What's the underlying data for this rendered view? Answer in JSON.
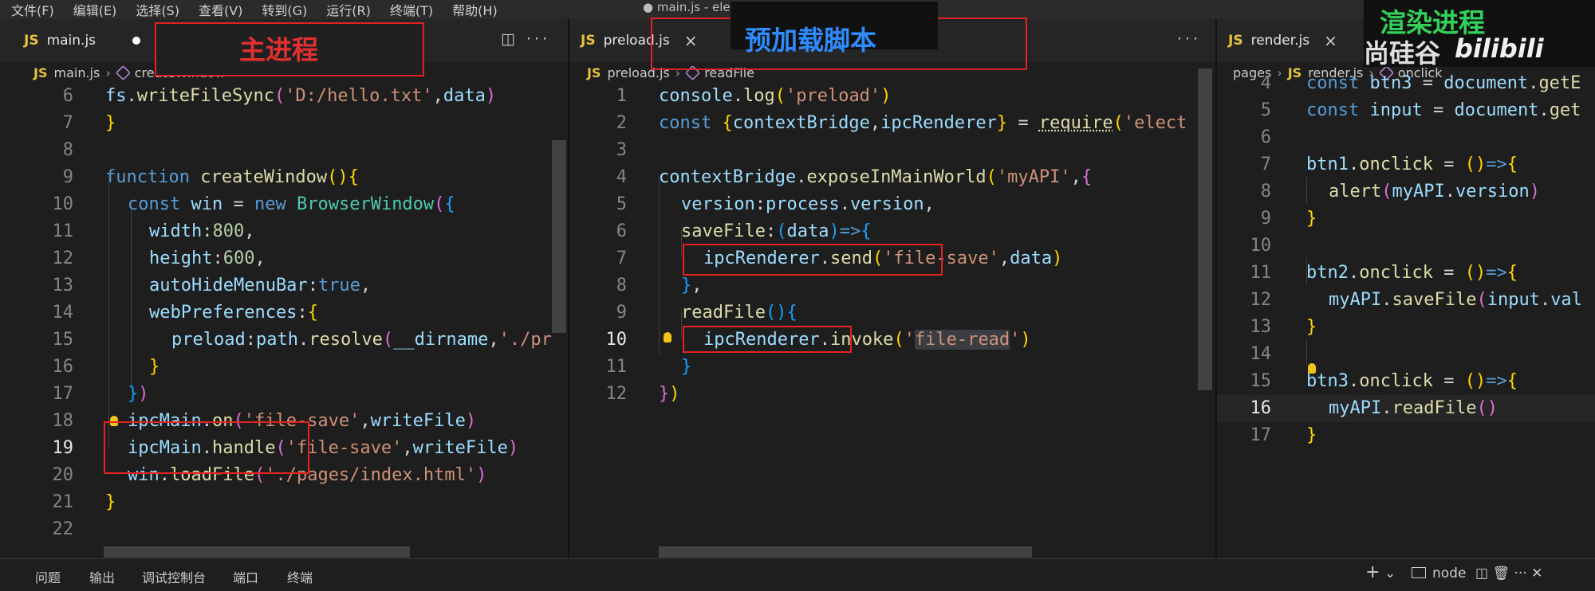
{
  "menubar": {
    "items": [
      "文件(F)",
      "编辑(E)",
      "选择(S)",
      "查看(V)",
      "转到(G)",
      "运行(R)",
      "终端(T)",
      "帮助(H)"
    ],
    "window_title": "● main.js - ele"
  },
  "overlays": {
    "main_process": "主进程",
    "preload_script": "预加载脚本",
    "render_process": "渲染进程",
    "watermark": "尚硅谷",
    "bilibili": "bilibili"
  },
  "colors": {
    "accent_red": "#e32222",
    "label_red": "#e23030",
    "label_blue": "#2f8cff",
    "label_green": "#33d15a"
  },
  "pane1": {
    "tab": {
      "prefix": "JS",
      "name": "main.js",
      "modified": true
    },
    "tools": "◫ ···",
    "breadcrumb": {
      "file": "main.js",
      "symbol": "createWindow"
    },
    "lines": [
      {
        "n": "6",
        "t": "  fs.writeFileSync('D:/hello.txt',data)"
      },
      {
        "n": "7",
        "t": "}"
      },
      {
        "n": "8",
        "t": ""
      },
      {
        "n": "9",
        "t": "function createWindow(){"
      },
      {
        "n": "10",
        "t": "  const win = new BrowserWindow({"
      },
      {
        "n": "11",
        "t": "    width:800,"
      },
      {
        "n": "12",
        "t": "    height:600,"
      },
      {
        "n": "13",
        "t": "    autoHideMenuBar:true,"
      },
      {
        "n": "14",
        "t": "    webPreferences:{"
      },
      {
        "n": "15",
        "t": "      preload:path.resolve(__dirname,'./pr"
      },
      {
        "n": "16",
        "t": "    }"
      },
      {
        "n": "17",
        "t": "  })"
      },
      {
        "n": "18",
        "t": "  ipcMain.on('file-save',writeFile)"
      },
      {
        "n": "19",
        "t": "  ipcMain.handle('file-save',writeFile)"
      },
      {
        "n": "20",
        "t": "  win.loadFile('./pages/index.html')"
      },
      {
        "n": "21",
        "t": "}"
      },
      {
        "n": "22",
        "t": ""
      }
    ]
  },
  "pane2": {
    "tab": {
      "prefix": "JS",
      "name": "preload.js",
      "close": "×"
    },
    "tools": "···",
    "breadcrumb": {
      "file": "preload.js",
      "symbol": "readFile"
    },
    "lines": [
      {
        "n": "1",
        "t": "console.log('preload')"
      },
      {
        "n": "2",
        "t": "const {contextBridge,ipcRenderer} = require('elect"
      },
      {
        "n": "3",
        "t": ""
      },
      {
        "n": "4",
        "t": "contextBridge.exposeInMainWorld('myAPI',{"
      },
      {
        "n": "5",
        "t": "  version:process.version,"
      },
      {
        "n": "6",
        "t": "  saveFile:(data)=>{"
      },
      {
        "n": "7",
        "t": "    ipcRenderer.send('file-save',data)"
      },
      {
        "n": "8",
        "t": "  },"
      },
      {
        "n": "9",
        "t": "  readFile(){"
      },
      {
        "n": "10",
        "t": "    ipcRenderer.invoke('file-read')"
      },
      {
        "n": "11",
        "t": "  }"
      },
      {
        "n": "12",
        "t": "})"
      }
    ]
  },
  "pane3": {
    "tab": {
      "prefix": "JS",
      "name": "render.js",
      "close": "×"
    },
    "breadcrumb": {
      "folder": "pages",
      "file": "render.js",
      "symbol": "onclick"
    },
    "lines": [
      {
        "n": "4",
        "t": "const btn3 = document.getE"
      },
      {
        "n": "5",
        "t": "const input = document.get"
      },
      {
        "n": "6",
        "t": ""
      },
      {
        "n": "7",
        "t": "btn1.onclick = ()=>{"
      },
      {
        "n": "8",
        "t": "  alert(myAPI.version)"
      },
      {
        "n": "9",
        "t": "}"
      },
      {
        "n": "10",
        "t": ""
      },
      {
        "n": "11",
        "t": "btn2.onclick = ()=>{"
      },
      {
        "n": "12",
        "t": "  myAPI.saveFile(input.val"
      },
      {
        "n": "13",
        "t": "}"
      },
      {
        "n": "14",
        "t": ""
      },
      {
        "n": "15",
        "t": "btn3.onclick = ()=>{"
      },
      {
        "n": "16",
        "t": "  myAPI.readFile()"
      },
      {
        "n": "17",
        "t": "}"
      }
    ]
  },
  "bottom_panel": {
    "tabs": [
      "问题",
      "输出",
      "调试控制台",
      "端口",
      "终端"
    ],
    "add": "+",
    "chevron": "⌄",
    "terminal_name": "node",
    "tools": "◫  🗑  ···  ✕"
  }
}
